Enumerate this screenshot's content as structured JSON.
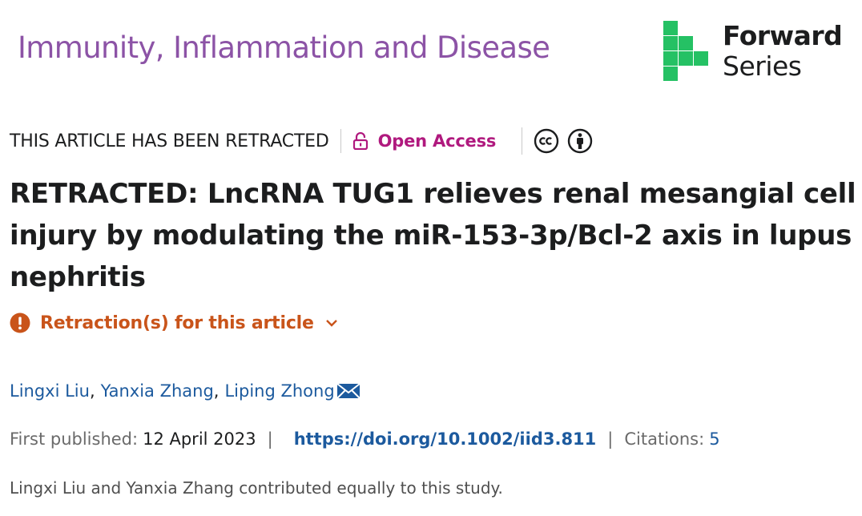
{
  "header": {
    "journal_title": "Immunity, Inflammation and Disease",
    "series_line1": "Forward",
    "series_line2": "Series",
    "series_logo_color": "#25c164"
  },
  "status": {
    "retracted_label": "THIS ARTICLE HAS BEEN RETRACTED",
    "open_access_label": "Open Access",
    "open_access_color": "#b0197e",
    "license_icons": [
      "creative-commons-icon",
      "attribution-icon"
    ]
  },
  "article": {
    "title": "RETRACTED: LncRNA TUG1 relieves renal mesangial cell injury by modulating the miR-153-3p/Bcl-2 axis in lupus nephritis"
  },
  "retraction": {
    "label": "Retraction(s) for this article",
    "color": "#c9541a"
  },
  "authors": [
    {
      "name": "Lingxi Liu"
    },
    {
      "name": "Yanxia Zhang"
    },
    {
      "name": "Liping Zhong"
    }
  ],
  "publication": {
    "first_published_label": "First published:",
    "first_published_date": "12 April 2023",
    "doi": "https://doi.org/10.1002/iid3.811",
    "citations_label": "Citations:",
    "citations_count": "5"
  },
  "note": "Lingxi Liu and Yanxia Zhang contributed equally to this study."
}
